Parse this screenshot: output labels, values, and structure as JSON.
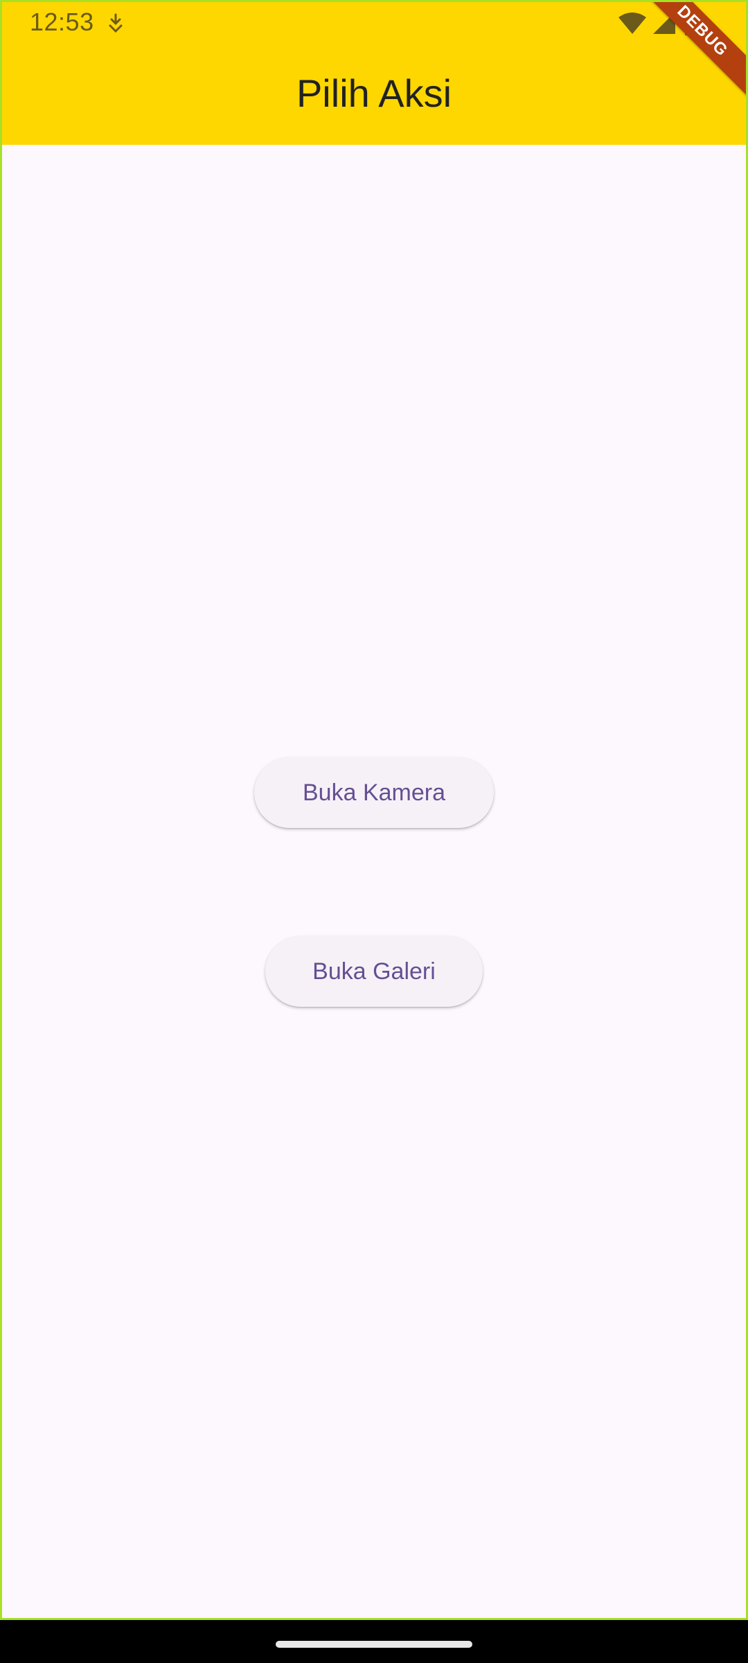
{
  "status_bar": {
    "time": "12:53",
    "notification_icon": "download-shield-icon",
    "wifi_icon": "wifi-icon",
    "signal_icon": "cell-signal-icon",
    "battery_icon": "battery-icon"
  },
  "appbar": {
    "title": "Pilih Aksi",
    "background_color": "#fed700"
  },
  "debug_banner": {
    "label": "DEBUG",
    "color": "#b4400f"
  },
  "actions": {
    "camera_label": "Buka Kamera",
    "gallery_label": "Buka Galeri",
    "text_color": "#654f93",
    "button_color": "#f6f1f7"
  },
  "page": {
    "background_color": "#fdf7fe"
  }
}
